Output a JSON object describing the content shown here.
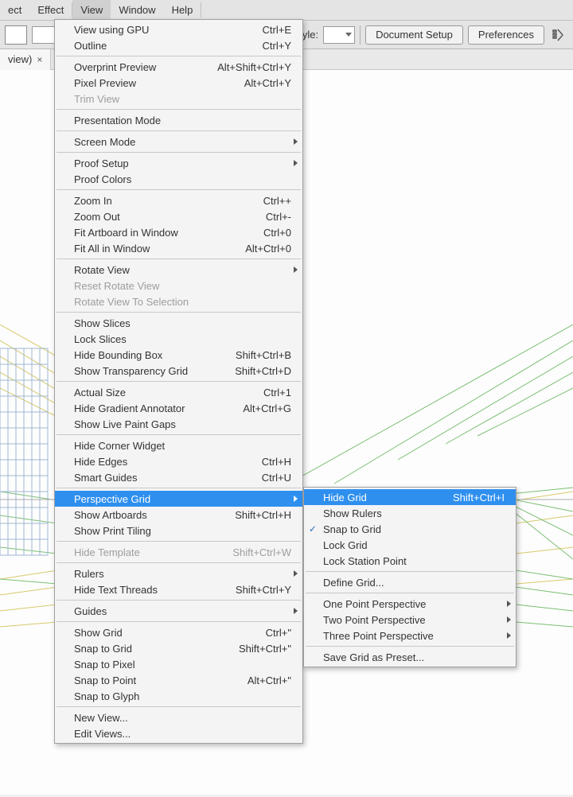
{
  "menubar": {
    "items": [
      "ect",
      "Effect",
      "View",
      "Window",
      "Help"
    ],
    "openIndex": 2
  },
  "toolbar": {
    "styleLabel": "Style:",
    "docSetup": "Document Setup",
    "prefs": "Preferences"
  },
  "tab": {
    "label": "view)",
    "close": "×"
  },
  "viewMenu": {
    "groups": [
      [
        {
          "label": "View using GPU",
          "shortcut": "Ctrl+E"
        },
        {
          "label": "Outline",
          "shortcut": "Ctrl+Y"
        }
      ],
      [
        {
          "label": "Overprint Preview",
          "shortcut": "Alt+Shift+Ctrl+Y"
        },
        {
          "label": "Pixel Preview",
          "shortcut": "Alt+Ctrl+Y"
        },
        {
          "label": "Trim View",
          "disabled": true
        }
      ],
      [
        {
          "label": "Presentation Mode"
        }
      ],
      [
        {
          "label": "Screen Mode",
          "submenu": true
        }
      ],
      [
        {
          "label": "Proof Setup",
          "submenu": true
        },
        {
          "label": "Proof Colors"
        }
      ],
      [
        {
          "label": "Zoom In",
          "shortcut": "Ctrl++"
        },
        {
          "label": "Zoom Out",
          "shortcut": "Ctrl+-"
        },
        {
          "label": "Fit Artboard in Window",
          "shortcut": "Ctrl+0"
        },
        {
          "label": "Fit All in Window",
          "shortcut": "Alt+Ctrl+0"
        }
      ],
      [
        {
          "label": "Rotate View",
          "submenu": true
        },
        {
          "label": "Reset Rotate View",
          "disabled": true
        },
        {
          "label": "Rotate View To Selection",
          "disabled": true
        }
      ],
      [
        {
          "label": "Show Slices"
        },
        {
          "label": "Lock Slices"
        },
        {
          "label": "Hide Bounding Box",
          "shortcut": "Shift+Ctrl+B"
        },
        {
          "label": "Show Transparency Grid",
          "shortcut": "Shift+Ctrl+D"
        }
      ],
      [
        {
          "label": "Actual Size",
          "shortcut": "Ctrl+1"
        },
        {
          "label": "Hide Gradient Annotator",
          "shortcut": "Alt+Ctrl+G"
        },
        {
          "label": "Show Live Paint Gaps"
        }
      ],
      [
        {
          "label": "Hide Corner Widget"
        },
        {
          "label": "Hide Edges",
          "shortcut": "Ctrl+H"
        },
        {
          "label": "Smart Guides",
          "shortcut": "Ctrl+U"
        }
      ],
      [
        {
          "label": "Perspective Grid",
          "submenu": true,
          "highlight": true
        },
        {
          "label": "Show Artboards",
          "shortcut": "Shift+Ctrl+H"
        },
        {
          "label": "Show Print Tiling"
        }
      ],
      [
        {
          "label": "Hide Template",
          "shortcut": "Shift+Ctrl+W",
          "disabled": true
        }
      ],
      [
        {
          "label": "Rulers",
          "submenu": true
        },
        {
          "label": "Hide Text Threads",
          "shortcut": "Shift+Ctrl+Y"
        }
      ],
      [
        {
          "label": "Guides",
          "submenu": true
        }
      ],
      [
        {
          "label": "Show Grid",
          "shortcut": "Ctrl+\""
        },
        {
          "label": "Snap to Grid",
          "shortcut": "Shift+Ctrl+\""
        },
        {
          "label": "Snap to Pixel"
        },
        {
          "label": "Snap to Point",
          "shortcut": "Alt+Ctrl+\""
        },
        {
          "label": "Snap to Glyph"
        }
      ],
      [
        {
          "label": "New View..."
        },
        {
          "label": "Edit Views..."
        }
      ]
    ]
  },
  "pgridMenu": {
    "groups": [
      [
        {
          "label": "Hide Grid",
          "shortcut": "Shift+Ctrl+I",
          "highlight": true
        },
        {
          "label": "Show Rulers"
        },
        {
          "label": "Snap to Grid",
          "checked": true
        },
        {
          "label": "Lock Grid"
        },
        {
          "label": "Lock Station Point"
        }
      ],
      [
        {
          "label": "Define Grid..."
        }
      ],
      [
        {
          "label": "One Point Perspective",
          "submenu": true
        },
        {
          "label": "Two Point Perspective",
          "submenu": true
        },
        {
          "label": "Three Point Perspective",
          "submenu": true
        }
      ],
      [
        {
          "label": "Save Grid as Preset..."
        }
      ]
    ]
  }
}
